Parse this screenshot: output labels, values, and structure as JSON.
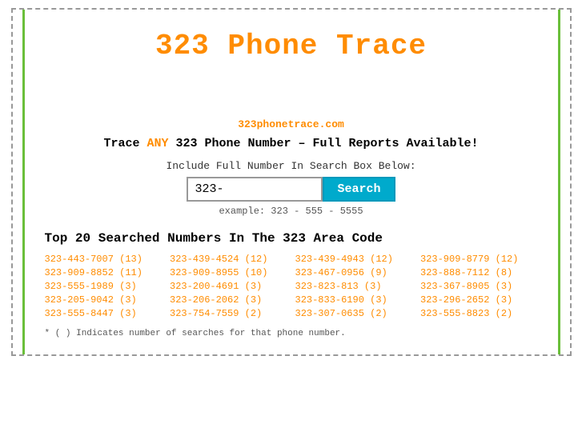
{
  "header": {
    "title": "323 Phone Trace"
  },
  "site_url": "323phonetrace.com",
  "tagline": {
    "prefix": "Trace ",
    "highlight": "ANY",
    "suffix": " 323 Phone Number – Full Reports Available!"
  },
  "search": {
    "label": "Include Full Number In Search Box Below:",
    "placeholder": "323-",
    "button_label": "Search",
    "example": "example: 323 - 555 - 5555"
  },
  "top_numbers": {
    "title": "Top 20 Searched Numbers In The 323 Area Code",
    "numbers": [
      "323-443-7007 (13)",
      "323-439-4524 (12)",
      "323-439-4943 (12)",
      "323-909-8779 (12)",
      "323-909-8852 (11)",
      "323-909-8955 (10)",
      "323-467-0956 (9)",
      "323-888-7112 (8)",
      "323-555-1989 (3)",
      "323-200-4691 (3)",
      "323-823-813 (3)",
      "323-367-8905 (3)",
      "323-205-9042 (3)",
      "323-206-2062 (3)",
      "323-833-6190 (3)",
      "323-296-2652 (3)",
      "323-555-8447 (3)",
      "323-754-7559 (2)",
      "323-307-0635 (2)",
      "323-555-8823 (2)"
    ]
  },
  "footnote": "* ( ) Indicates number of searches for that phone number."
}
